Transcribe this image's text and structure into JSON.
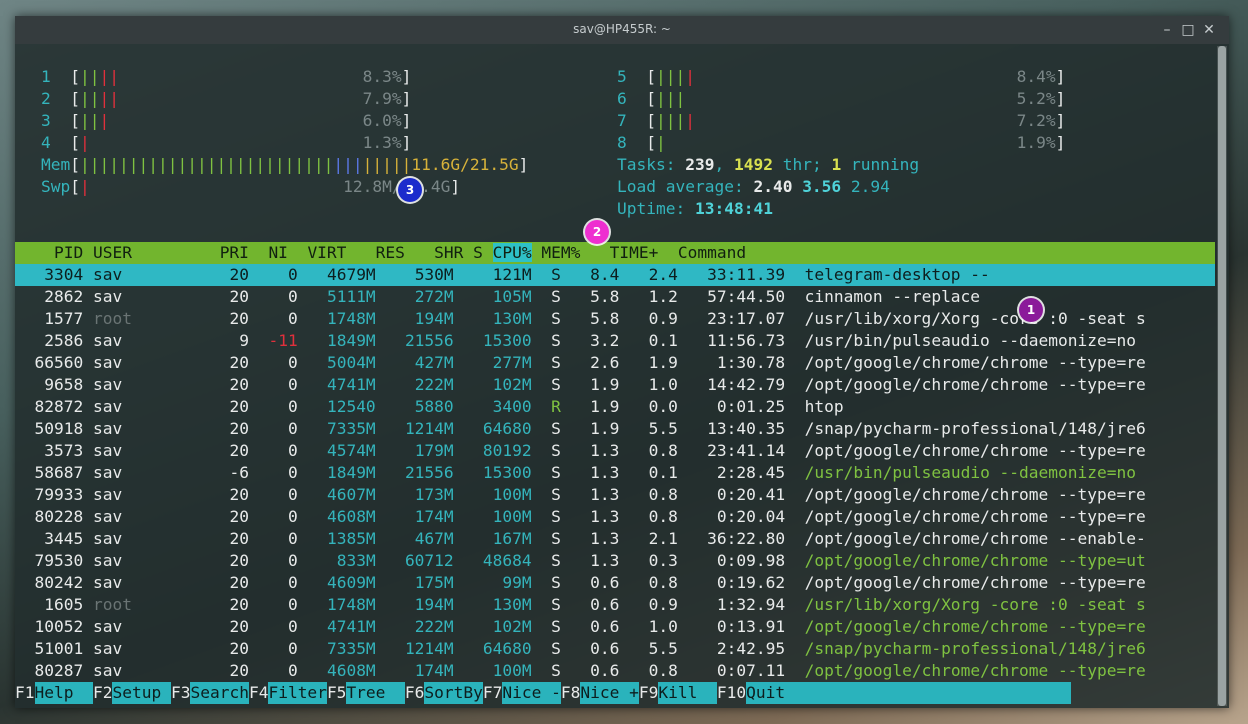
{
  "window": {
    "title": "sav@HP455R: ~"
  },
  "cpus": [
    {
      "num": "1",
      "pct": "8.3%"
    },
    {
      "num": "2",
      "pct": "7.9%"
    },
    {
      "num": "3",
      "pct": "6.0%"
    },
    {
      "num": "4",
      "pct": "1.3%"
    },
    {
      "num": "5",
      "pct": "8.4%"
    },
    {
      "num": "6",
      "pct": "5.2%"
    },
    {
      "num": "7",
      "pct": "7.2%"
    },
    {
      "num": "8",
      "pct": "1.9%"
    }
  ],
  "mem": {
    "label": "Mem",
    "value": "11.6G/21.5G"
  },
  "swp": {
    "label": "Swp",
    "value": "12.8M/21.4G"
  },
  "tasks": {
    "label": "Tasks: ",
    "count": "239",
    "sep": ", ",
    "thr": "1492",
    "thr_label": " thr; ",
    "running": "1",
    "running_label": " running"
  },
  "load": {
    "label": "Load average: ",
    "a": "2.40",
    "b": "3.56",
    "c": "2.94"
  },
  "uptime": {
    "label": "Uptime: ",
    "value": "13:48:41"
  },
  "columns": [
    "PID",
    "USER",
    "PRI",
    "NI",
    "VIRT",
    "RES",
    "SHR",
    "S",
    "CPU%",
    "MEM%",
    "TIME+",
    "Command"
  ],
  "processes": [
    {
      "pid": "3304",
      "user": "sav",
      "pri": "20",
      "ni": "0",
      "virt": "4679M",
      "res": "530M",
      "shr": "121M",
      "s": "S",
      "cpu": "8.4",
      "mem": "2.4",
      "time": "33:11.39",
      "cmd": "telegram-desktop --"
    },
    {
      "pid": "2862",
      "user": "sav",
      "pri": "20",
      "ni": "0",
      "virt": "5111M",
      "res": "272M",
      "shr": "105M",
      "s": "S",
      "cpu": "5.8",
      "mem": "1.2",
      "time": "57:44.50",
      "cmd": "cinnamon --replace"
    },
    {
      "pid": "1577",
      "user": "root",
      "pri": "20",
      "ni": "0",
      "virt": "1748M",
      "res": "194M",
      "shr": "130M",
      "s": "S",
      "cpu": "5.8",
      "mem": "0.9",
      "time": "23:17.07",
      "cmd": "/usr/lib/xorg/Xorg -core :0 -seat s"
    },
    {
      "pid": "2586",
      "user": "sav",
      "pri": "9",
      "ni": "-11",
      "virt": "1849M",
      "res": "21556",
      "shr": "15300",
      "s": "S",
      "cpu": "3.2",
      "mem": "0.1",
      "time": "11:56.73",
      "cmd": "/usr/bin/pulseaudio --daemonize=no"
    },
    {
      "pid": "66560",
      "user": "sav",
      "pri": "20",
      "ni": "0",
      "virt": "5004M",
      "res": "427M",
      "shr": "277M",
      "s": "S",
      "cpu": "2.6",
      "mem": "1.9",
      "time": "1:30.78",
      "cmd": "/opt/google/chrome/chrome --type=re"
    },
    {
      "pid": "9658",
      "user": "sav",
      "pri": "20",
      "ni": "0",
      "virt": "4741M",
      "res": "222M",
      "shr": "102M",
      "s": "S",
      "cpu": "1.9",
      "mem": "1.0",
      "time": "14:42.79",
      "cmd": "/opt/google/chrome/chrome --type=re"
    },
    {
      "pid": "82872",
      "user": "sav",
      "pri": "20",
      "ni": "0",
      "virt": "12540",
      "res": "5880",
      "shr": "3400",
      "s": "R",
      "cpu": "1.9",
      "mem": "0.0",
      "time": "0:01.25",
      "cmd": "htop"
    },
    {
      "pid": "50918",
      "user": "sav",
      "pri": "20",
      "ni": "0",
      "virt": "7335M",
      "res": "1214M",
      "shr": "64680",
      "s": "S",
      "cpu": "1.9",
      "mem": "5.5",
      "time": "13:40.35",
      "cmd": "/snap/pycharm-professional/148/jre6"
    },
    {
      "pid": "3573",
      "user": "sav",
      "pri": "20",
      "ni": "0",
      "virt": "4574M",
      "res": "179M",
      "shr": "80192",
      "s": "S",
      "cpu": "1.3",
      "mem": "0.8",
      "time": "23:41.14",
      "cmd": "/opt/google/chrome/chrome --type=re"
    },
    {
      "pid": "58687",
      "user": "sav",
      "pri": "-6",
      "ni": "0",
      "virt": "1849M",
      "res": "21556",
      "shr": "15300",
      "s": "S",
      "cpu": "1.3",
      "mem": "0.1",
      "time": "2:28.45",
      "cmd": "/usr/bin/pulseaudio --daemonize=no"
    },
    {
      "pid": "79933",
      "user": "sav",
      "pri": "20",
      "ni": "0",
      "virt": "4607M",
      "res": "173M",
      "shr": "100M",
      "s": "S",
      "cpu": "1.3",
      "mem": "0.8",
      "time": "0:20.41",
      "cmd": "/opt/google/chrome/chrome --type=re"
    },
    {
      "pid": "80228",
      "user": "sav",
      "pri": "20",
      "ni": "0",
      "virt": "4608M",
      "res": "174M",
      "shr": "100M",
      "s": "S",
      "cpu": "1.3",
      "mem": "0.8",
      "time": "0:20.04",
      "cmd": "/opt/google/chrome/chrome --type=re"
    },
    {
      "pid": "3445",
      "user": "sav",
      "pri": "20",
      "ni": "0",
      "virt": "1385M",
      "res": "467M",
      "shr": "167M",
      "s": "S",
      "cpu": "1.3",
      "mem": "2.1",
      "time": "36:22.80",
      "cmd": "/opt/google/chrome/chrome --enable-"
    },
    {
      "pid": "79530",
      "user": "sav",
      "pri": "20",
      "ni": "0",
      "virt": "833M",
      "res": "60712",
      "shr": "48684",
      "s": "S",
      "cpu": "1.3",
      "mem": "0.3",
      "time": "0:09.98",
      "cmd": "/opt/google/chrome/chrome --type=ut"
    },
    {
      "pid": "80242",
      "user": "sav",
      "pri": "20",
      "ni": "0",
      "virt": "4609M",
      "res": "175M",
      "shr": "99M",
      "s": "S",
      "cpu": "0.6",
      "mem": "0.8",
      "time": "0:19.62",
      "cmd": "/opt/google/chrome/chrome --type=re"
    },
    {
      "pid": "1605",
      "user": "root",
      "pri": "20",
      "ni": "0",
      "virt": "1748M",
      "res": "194M",
      "shr": "130M",
      "s": "S",
      "cpu": "0.6",
      "mem": "0.9",
      "time": "1:32.94",
      "cmd": "/usr/lib/xorg/Xorg -core :0 -seat s"
    },
    {
      "pid": "10052",
      "user": "sav",
      "pri": "20",
      "ni": "0",
      "virt": "4741M",
      "res": "222M",
      "shr": "102M",
      "s": "S",
      "cpu": "0.6",
      "mem": "1.0",
      "time": "0:13.91",
      "cmd": "/opt/google/chrome/chrome --type=re"
    },
    {
      "pid": "51001",
      "user": "sav",
      "pri": "20",
      "ni": "0",
      "virt": "7335M",
      "res": "1214M",
      "shr": "64680",
      "s": "S",
      "cpu": "0.6",
      "mem": "5.5",
      "time": "2:42.95",
      "cmd": "/snap/pycharm-professional/148/jre6"
    },
    {
      "pid": "80287",
      "user": "sav",
      "pri": "20",
      "ni": "0",
      "virt": "4608M",
      "res": "174M",
      "shr": "100M",
      "s": "S",
      "cpu": "0.6",
      "mem": "0.8",
      "time": "0:07.11",
      "cmd": "/opt/google/chrome/chrome --type=re"
    }
  ],
  "fkeys": [
    {
      "key": "F1",
      "label": "Help  "
    },
    {
      "key": "F2",
      "label": "Setup "
    },
    {
      "key": "F3",
      "label": "Search"
    },
    {
      "key": "F4",
      "label": "Filter"
    },
    {
      "key": "F5",
      "label": "Tree  "
    },
    {
      "key": "F6",
      "label": "SortBy"
    },
    {
      "key": "F7",
      "label": "Nice -"
    },
    {
      "key": "F8",
      "label": "Nice +"
    },
    {
      "key": "F9",
      "label": "Kill  "
    },
    {
      "key": "F10",
      "label": "Quit"
    }
  ],
  "badges": [
    "1",
    "2",
    "3"
  ],
  "colors": {
    "header_bg": "#72b52e",
    "selected_row": "#2fb8c4",
    "accent_teal": "#34b4bc",
    "badge1": "#8b1a9a",
    "badge2": "#ee2fd0",
    "badge3": "#1c2bcc"
  }
}
